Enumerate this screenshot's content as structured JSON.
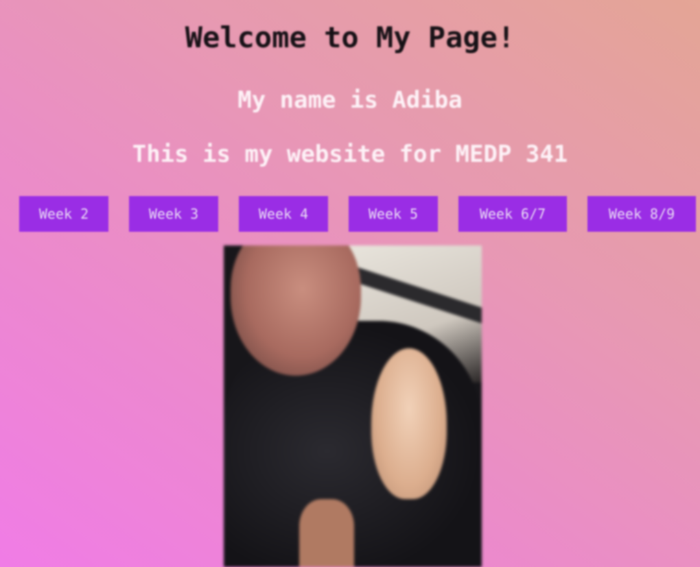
{
  "header": {
    "title": "Welcome to My Page!",
    "name_line": "My name is Adiba",
    "description": "This is my website for MEDP 341"
  },
  "nav": {
    "items": [
      {
        "label": "Week 2"
      },
      {
        "label": "Week 3"
      },
      {
        "label": "Week 4"
      },
      {
        "label": "Week 5"
      },
      {
        "label": "Week 6/7"
      },
      {
        "label": "Week 8/9"
      }
    ]
  },
  "colors": {
    "button_bg": "#9a2de5",
    "title_color": "#161116",
    "subtitle_color": "#fdf2f7"
  }
}
